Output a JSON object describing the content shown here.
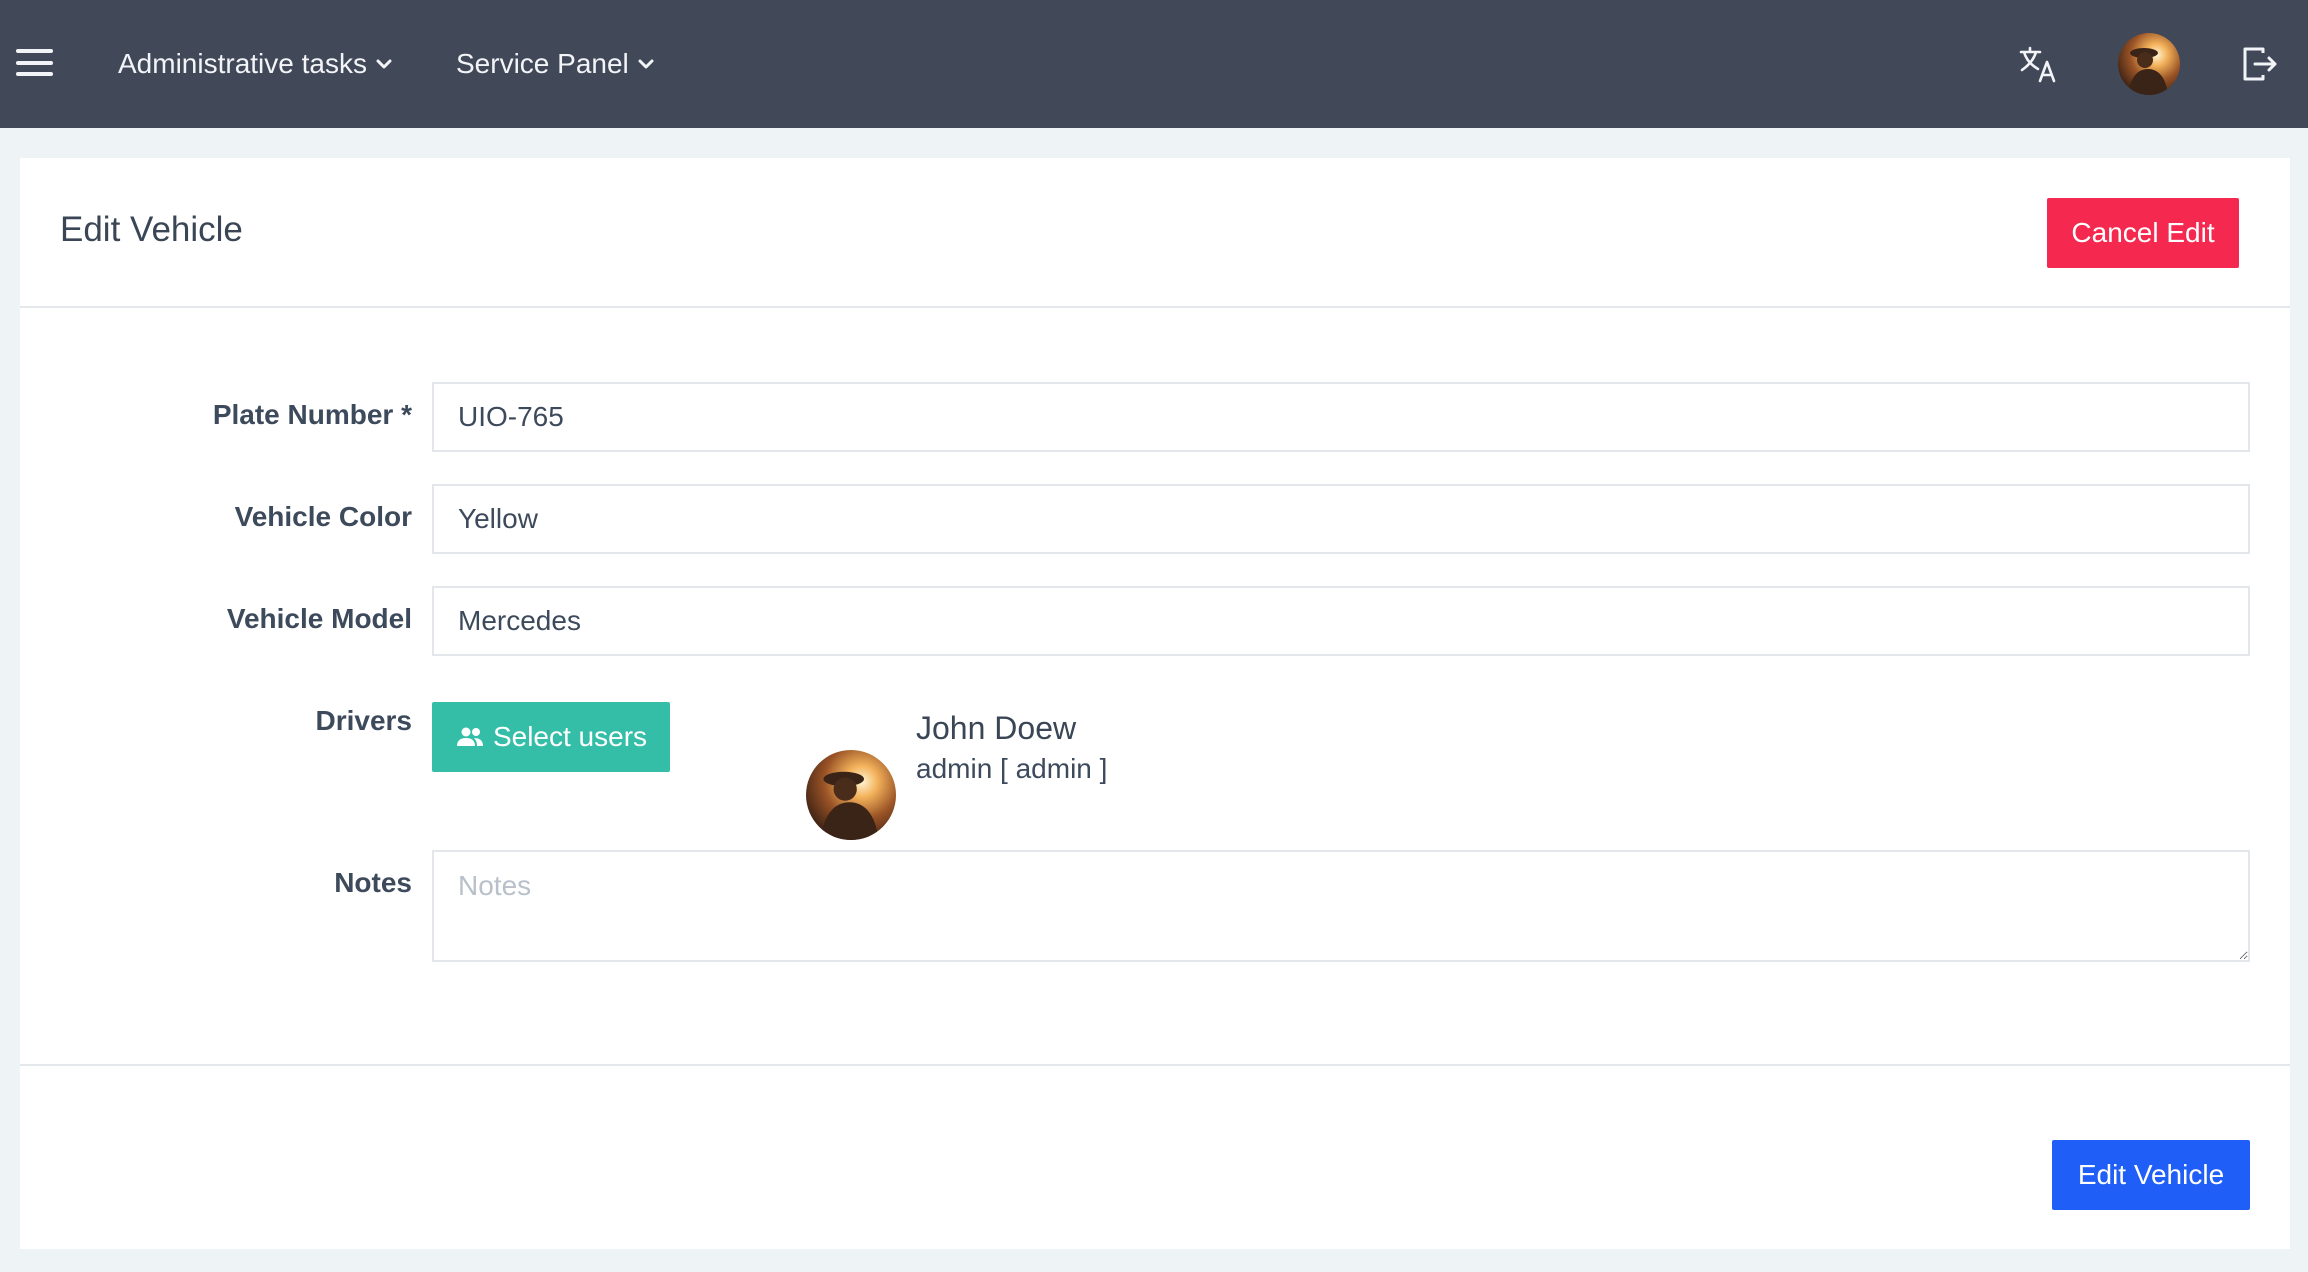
{
  "navbar": {
    "menu_icon": "hamburger-menu-icon",
    "menus": [
      {
        "label": "Administrative tasks",
        "icon": "chevron-down-icon"
      },
      {
        "label": "Service Panel",
        "icon": "chevron-down-icon"
      }
    ],
    "translate_icon": "translate-icon",
    "avatar_icon": "user-avatar",
    "logout_icon": "logout-icon"
  },
  "page": {
    "title": "Edit Vehicle",
    "cancel_label": "Cancel Edit",
    "submit_label": "Edit Vehicle"
  },
  "form": {
    "plate": {
      "label": "Plate Number *",
      "value": "UIO-765"
    },
    "color": {
      "label": "Vehicle Color",
      "value": "Yellow"
    },
    "model": {
      "label": "Vehicle Model",
      "value": "Mercedes"
    },
    "drivers": {
      "label": "Drivers",
      "select_label": "Select users",
      "select_icon": "users-icon",
      "selected": [
        {
          "name": "John Doew",
          "role": "admin [ admin ]"
        }
      ]
    },
    "notes": {
      "label": "Notes",
      "placeholder": "Notes",
      "value": ""
    }
  },
  "colors": {
    "navbar": "#414858",
    "cancel": "#f5284f",
    "select": "#34bea8",
    "submit": "#1f5ef7"
  }
}
